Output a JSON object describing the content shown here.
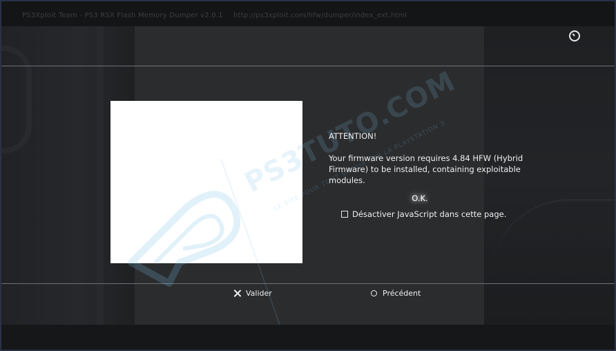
{
  "topbar": {
    "title": "PS3Xploit Team - PS3 RSX Flash Memory Dumper v2.0.1",
    "url": "http://ps3xploit.com/hfw/dumper/index_ext.html"
  },
  "dialog": {
    "title": "ATTENTION!",
    "message": "Your firmware version requires 4.84 HFW (Hybrid Firmware) to be installed, containing exploitable modules.",
    "ok_label": "O.K.",
    "checkbox_label": "Désactiver JavaScript dans cette page."
  },
  "watermark": {
    "main": "PS3TUTO.COM",
    "tagline": "LE SITE POUR TOUT SAVOIR SUR LA PLAYSTATION 3"
  },
  "nav": {
    "confirm_label": "Valider",
    "back_label": "Précédent"
  },
  "icons": {
    "clock": "clock-icon",
    "confirm": "cross-icon",
    "back": "circle-icon"
  },
  "colors": {
    "background": "#1b1c1e",
    "panel": "#2b2c2e",
    "text": "#f0f0f0",
    "watermark": "#78bee6"
  }
}
